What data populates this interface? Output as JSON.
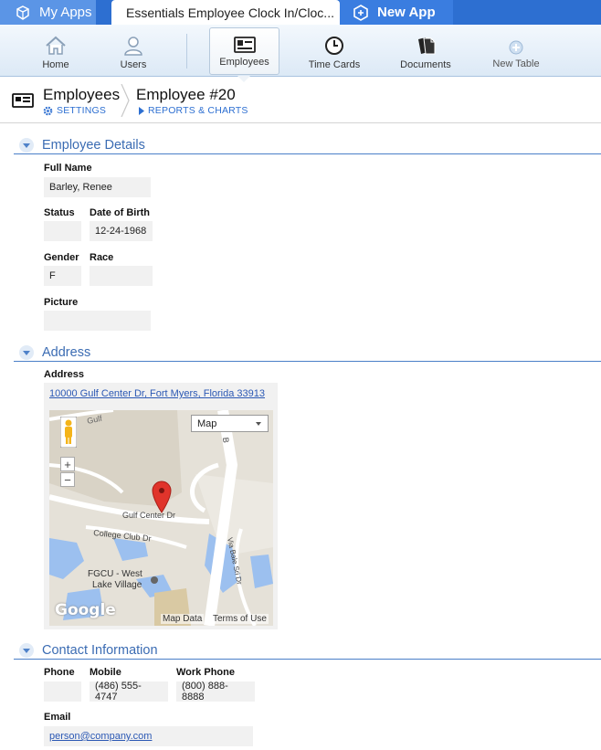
{
  "tabs": {
    "my_apps": "My Apps",
    "current_app": "Essentials Employee Clock In/Cloc...",
    "new_app": "New App"
  },
  "toolbar": {
    "items": [
      {
        "label": "Home",
        "icon": "home-icon"
      },
      {
        "label": "Users",
        "icon": "users-icon"
      },
      {
        "label": "Employees",
        "icon": "id-card-icon"
      },
      {
        "label": "Time Cards",
        "icon": "clock-icon"
      },
      {
        "label": "Documents",
        "icon": "documents-icon"
      },
      {
        "label": "New Table",
        "icon": "plus-icon"
      }
    ],
    "active": "Employees"
  },
  "breadcrumb": {
    "table": "Employees",
    "settings": "SETTINGS",
    "record": "Employee #20",
    "reports": "REPORTS & CHARTS"
  },
  "employee_details": {
    "title": "Employee Details",
    "full_name_label": "Full Name",
    "full_name": "Barley, Renee",
    "status_label": "Status",
    "status": "",
    "dob_label": "Date of Birth",
    "dob": "12-24-1968",
    "gender_label": "Gender",
    "gender": "F",
    "race_label": "Race",
    "race": "",
    "picture_label": "Picture",
    "picture": ""
  },
  "address": {
    "title": "Address",
    "label": "Address",
    "value": "10000 Gulf Center Dr, Fort Myers, Florida 33913",
    "map": {
      "type_select": "Map",
      "zoom_in": "+",
      "zoom_out": "−",
      "street_1": "Gulf Center Dr",
      "street_2": "College Club Dr",
      "street_3": "Via Bale Sri Dr",
      "street_4": "Gulf",
      "street_5": "B",
      "place": "FGCU - West",
      "place_2": "Lake Village",
      "logo": "Google",
      "map_data": "Map Data",
      "terms": "Terms of Use"
    }
  },
  "contact": {
    "title": "Contact Information",
    "phone_label": "Phone",
    "phone": "",
    "mobile_label": "Mobile",
    "mobile": "(486) 555-4747",
    "work_label": "Work Phone",
    "work": "(800) 888-8888",
    "email_label": "Email",
    "email": "person@company.com"
  },
  "colors": {
    "top_bar": "#2d6fd1",
    "accent": "#3b6cb3",
    "field_bg": "#f1f1f1",
    "pin": "#e0342b"
  }
}
